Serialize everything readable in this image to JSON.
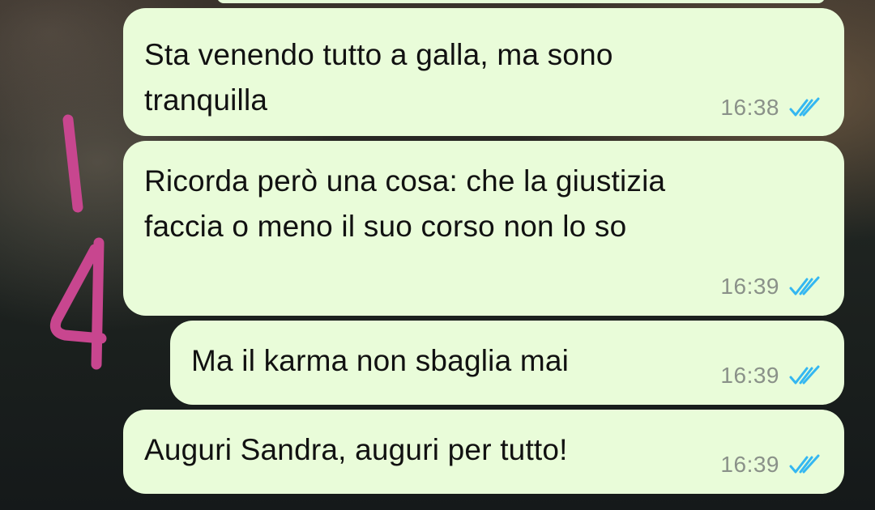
{
  "messages": [
    {
      "text_line1": "Sta venendo tutto a galla, ma sono",
      "text_line2": "tranquilla",
      "time": "16:38",
      "status": "read"
    },
    {
      "text_line1": "Ricorda però una cosa: che la giustizia",
      "text_line2": "faccia o meno il suo corso non lo so",
      "time": "16:39",
      "status": "read"
    },
    {
      "text": "Ma il karma non sbaglia mai",
      "time": "16:39",
      "status": "read"
    },
    {
      "text": "Auguri Sandra, auguri per tutto!",
      "time": "16:39",
      "status": "read"
    }
  ],
  "annotation": {
    "text": "4",
    "color": "#c8468f"
  },
  "colors": {
    "bubble": "#e9fcd9",
    "tick": "#34b7f1",
    "time": "#8a9189"
  }
}
